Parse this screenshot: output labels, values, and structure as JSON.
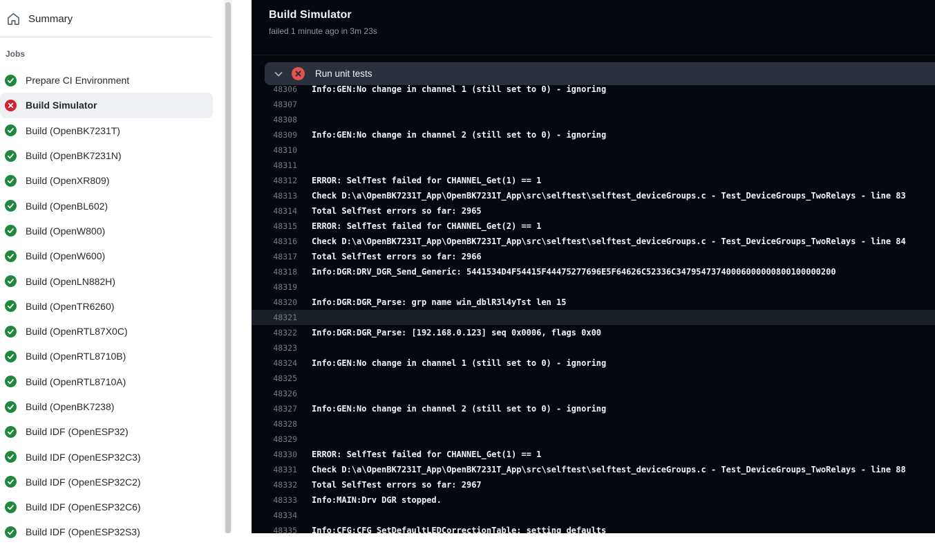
{
  "colors": {
    "success_green": "#1f883d",
    "failure_red": "#d1242f",
    "step_failure_red": "#e5534b",
    "selected_row_bg": "#eef0f3",
    "log_bg": "#04070c",
    "step_header_bg": "#2b313c"
  },
  "sidebar": {
    "summary_label": "Summary",
    "jobs_header": "Jobs",
    "jobs": [
      {
        "label": "Prepare CI Environment",
        "status": "success",
        "selected": false
      },
      {
        "label": "Build Simulator",
        "status": "failure",
        "selected": true
      },
      {
        "label": "Build (OpenBK7231T)",
        "status": "success",
        "selected": false
      },
      {
        "label": "Build (OpenBK7231N)",
        "status": "success",
        "selected": false
      },
      {
        "label": "Build (OpenXR809)",
        "status": "success",
        "selected": false
      },
      {
        "label": "Build (OpenBL602)",
        "status": "success",
        "selected": false
      },
      {
        "label": "Build (OpenW800)",
        "status": "success",
        "selected": false
      },
      {
        "label": "Build (OpenW600)",
        "status": "success",
        "selected": false
      },
      {
        "label": "Build (OpenLN882H)",
        "status": "success",
        "selected": false
      },
      {
        "label": "Build (OpenTR6260)",
        "status": "success",
        "selected": false
      },
      {
        "label": "Build (OpenRTL87X0C)",
        "status": "success",
        "selected": false
      },
      {
        "label": "Build (OpenRTL8710B)",
        "status": "success",
        "selected": false
      },
      {
        "label": "Build (OpenRTL8710A)",
        "status": "success",
        "selected": false
      },
      {
        "label": "Build (OpenBK7238)",
        "status": "success",
        "selected": false
      },
      {
        "label": "Build IDF (OpenESP32)",
        "status": "success",
        "selected": false
      },
      {
        "label": "Build IDF (OpenESP32C3)",
        "status": "success",
        "selected": false
      },
      {
        "label": "Build IDF (OpenESP32C2)",
        "status": "success",
        "selected": false
      },
      {
        "label": "Build IDF (OpenESP32C6)",
        "status": "success",
        "selected": false
      },
      {
        "label": "Build IDF (OpenESP32S3)",
        "status": "success",
        "selected": false
      }
    ]
  },
  "header": {
    "title": "Build Simulator",
    "subtitle": "failed 1 minute ago in 3m 23s"
  },
  "step": {
    "label": "Run unit tests",
    "status": "failure"
  },
  "log": {
    "highlighted_line": 48321,
    "lines": [
      {
        "num": 48306,
        "text": "Info:GEN:No change in channel 1 (still set to 0) - ignoring"
      },
      {
        "num": 48307,
        "text": ""
      },
      {
        "num": 48308,
        "text": ""
      },
      {
        "num": 48309,
        "text": "Info:GEN:No change in channel 2 (still set to 0) - ignoring"
      },
      {
        "num": 48310,
        "text": ""
      },
      {
        "num": 48311,
        "text": ""
      },
      {
        "num": 48312,
        "text": "ERROR: SelfTest failed for CHANNEL_Get(1) == 1"
      },
      {
        "num": 48313,
        "text": "Check D:\\a\\OpenBK7231T_App\\OpenBK7231T_App\\src\\selftest\\selftest_deviceGroups.c - Test_DeviceGroups_TwoRelays - line 83"
      },
      {
        "num": 48314,
        "text": "Total SelfTest errors so far: 2965"
      },
      {
        "num": 48315,
        "text": "ERROR: SelfTest failed for CHANNEL_Get(2) == 1"
      },
      {
        "num": 48316,
        "text": "Check D:\\a\\OpenBK7231T_App\\OpenBK7231T_App\\src\\selftest\\selftest_deviceGroups.c - Test_DeviceGroups_TwoRelays - line 84"
      },
      {
        "num": 48317,
        "text": "Total SelfTest errors so far: 2966"
      },
      {
        "num": 48318,
        "text": "Info:DGR:DRV_DGR_Send_Generic: 5441534D4F54415F44475277696E5F64626C52336C34795473740006000000800100000200"
      },
      {
        "num": 48319,
        "text": ""
      },
      {
        "num": 48320,
        "text": "Info:DGR:DGR_Parse: grp name win_dblR3l4yTst len 15"
      },
      {
        "num": 48321,
        "text": ""
      },
      {
        "num": 48322,
        "text": "Info:DGR:DGR_Parse: [192.168.0.123] seq 0x0006, flags 0x00"
      },
      {
        "num": 48323,
        "text": ""
      },
      {
        "num": 48324,
        "text": "Info:GEN:No change in channel 1 (still set to 0) - ignoring"
      },
      {
        "num": 48325,
        "text": ""
      },
      {
        "num": 48326,
        "text": ""
      },
      {
        "num": 48327,
        "text": "Info:GEN:No change in channel 2 (still set to 0) - ignoring"
      },
      {
        "num": 48328,
        "text": ""
      },
      {
        "num": 48329,
        "text": ""
      },
      {
        "num": 48330,
        "text": "ERROR: SelfTest failed for CHANNEL_Get(1) == 1"
      },
      {
        "num": 48331,
        "text": "Check D:\\a\\OpenBK7231T_App\\OpenBK7231T_App\\src\\selftest\\selftest_deviceGroups.c - Test_DeviceGroups_TwoRelays - line 88"
      },
      {
        "num": 48332,
        "text": "Total SelfTest errors so far: 2967"
      },
      {
        "num": 48333,
        "text": "Info:MAIN:Drv DGR stopped."
      },
      {
        "num": 48334,
        "text": ""
      },
      {
        "num": 48335,
        "text": "Info:CFG:CFG_SetDefaultLEDCorrectionTable: setting defaults"
      }
    ]
  }
}
